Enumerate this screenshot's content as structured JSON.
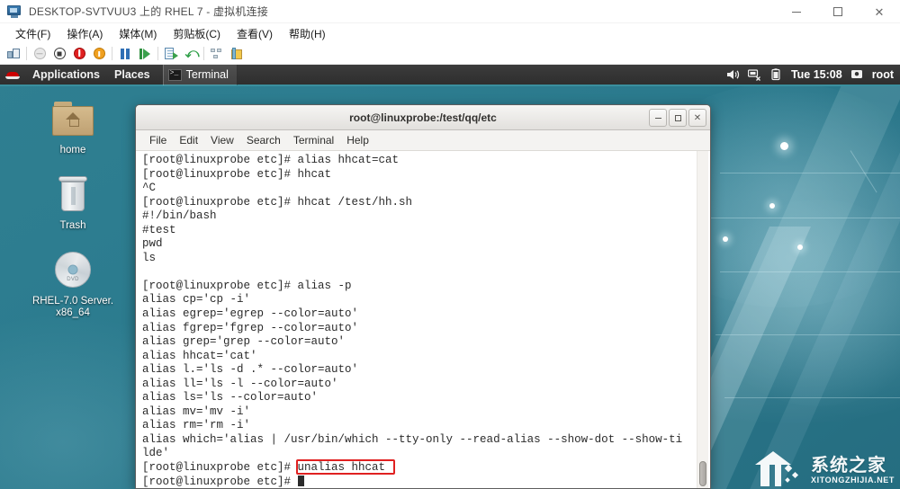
{
  "vm_window": {
    "title": "DESKTOP-SVTVUU3 上的 RHEL 7 - 虚拟机连接",
    "icon": "virtual-machine-icon",
    "controls": {
      "minimize": "—",
      "maximize": "□",
      "close": "✕"
    },
    "menus": [
      {
        "label": "文件(F)",
        "name": "file"
      },
      {
        "label": "操作(A)",
        "name": "action"
      },
      {
        "label": "媒体(M)",
        "name": "media"
      },
      {
        "label": "剪贴板(C)",
        "name": "clipboard"
      },
      {
        "label": "查看(V)",
        "name": "view"
      },
      {
        "label": "帮助(H)",
        "name": "help"
      }
    ],
    "toolbar": [
      {
        "name": "ctrl-alt-del-icon",
        "type": "cad",
        "enabled": true
      },
      {
        "type": "separator"
      },
      {
        "name": "start-icon",
        "type": "gray-circle",
        "enabled": false
      },
      {
        "name": "shutdown-icon",
        "type": "stop-circle",
        "enabled": true
      },
      {
        "name": "power-off-icon",
        "type": "red-circle",
        "enabled": true
      },
      {
        "name": "reset-icon",
        "type": "orange-circle",
        "enabled": true
      },
      {
        "type": "separator"
      },
      {
        "name": "pause-icon",
        "type": "pause",
        "enabled": true
      },
      {
        "name": "resume-icon",
        "type": "play",
        "enabled": true
      },
      {
        "type": "separator"
      },
      {
        "name": "checkpoint-icon",
        "type": "snapshot",
        "enabled": true
      },
      {
        "name": "revert-icon",
        "type": "revert",
        "enabled": true
      },
      {
        "type": "separator"
      },
      {
        "name": "network-settings-icon",
        "type": "grid",
        "enabled": false
      },
      {
        "name": "enhanced-session-icon",
        "type": "package",
        "enabled": true
      }
    ]
  },
  "gnome_panel": {
    "logo": "redhat-logo-icon",
    "applications": "Applications",
    "places": "Places",
    "active_window": "Terminal",
    "active_window_icon": "terminal-icon",
    "status_icons": [
      "volume-icon",
      "network-icon",
      "battery-icon"
    ],
    "clock": "Tue 15:08",
    "user": "root",
    "user_icon": "user-icon",
    "accent_color": "#3a8f9e",
    "panel_color": "#333333"
  },
  "desktop": {
    "icons": [
      {
        "name": "home-folder-icon",
        "label": "home",
        "glyph": "home"
      },
      {
        "name": "trash-icon",
        "label": "Trash",
        "glyph": "trash"
      },
      {
        "name": "dvd-drive-icon",
        "label": "RHEL-7.0 Server.\nx86_64",
        "label_line1": "RHEL-7.0 Server.",
        "label_line2": "x86_64",
        "glyph": "dvd"
      }
    ],
    "wallpaper_color": "#2d7d90"
  },
  "terminal": {
    "title": "root@linuxprobe:/test/qq/etc",
    "window_controls": {
      "minimize": "_",
      "maximize": "□",
      "close": "✕"
    },
    "menus": [
      "File",
      "Edit",
      "View",
      "Search",
      "Terminal",
      "Help"
    ],
    "prompt": "[root@linuxprobe etc]# ",
    "background": "#ffffff",
    "foreground": "#2b2b2b",
    "lines": [
      "[root@linuxprobe etc]# alias hhcat=cat",
      "[root@linuxprobe etc]# hhcat",
      "^C",
      "[root@linuxprobe etc]# hhcat /test/hh.sh",
      "#!/bin/bash",
      "#test",
      "pwd",
      "ls",
      "",
      "[root@linuxprobe etc]# alias -p",
      "alias cp='cp -i'",
      "alias egrep='egrep --color=auto'",
      "alias fgrep='fgrep --color=auto'",
      "alias grep='grep --color=auto'",
      "alias hhcat='cat'",
      "alias l.='ls -d .* --color=auto'",
      "alias ll='ls -l --color=auto'",
      "alias ls='ls --color=auto'",
      "alias mv='mv -i'",
      "alias rm='rm -i'",
      "alias which='alias | /usr/bin/which --tty-only --read-alias --show-dot --show-ti",
      "lde'"
    ],
    "highlighted_command": {
      "prompt": "[root@linuxprobe etc]# ",
      "command": "unalias hhcat",
      "box_color": "#e02020"
    },
    "final_prompt": "[root@linuxprobe etc]# ",
    "cursor": "block"
  },
  "watermark": {
    "chinese": "系统之家",
    "english": "XITONGZHIJIA.NET"
  }
}
